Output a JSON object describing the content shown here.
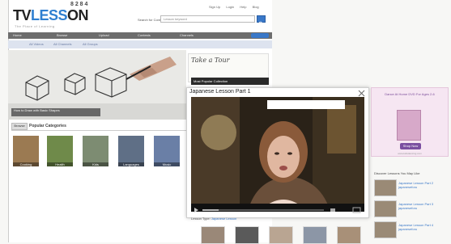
{
  "header": {
    "logo_a": "TV",
    "logo_b": "LESS",
    "logo_c": "ON",
    "logo_extra": "8 2 8 4",
    "tagline": "The Place of Learning",
    "top_links": [
      "Sign Up",
      "Login",
      "Help",
      "Blog"
    ],
    "search_label": "Search for Content",
    "search_placeholder": "Lesson keyword"
  },
  "nav": {
    "items": [
      "Home",
      "Browse",
      "Upload",
      "Contests",
      "Channels"
    ],
    "button": "Upload"
  },
  "subnav": [
    "All Videos",
    "All Channels",
    "All Groups"
  ],
  "hero": {
    "caption": "How to Draw with Basic Shapes"
  },
  "tour": {
    "title": "Take a Tour",
    "tag": "Most Popular Collection"
  },
  "popular": {
    "button": "Browse",
    "label": "Popular Categories",
    "categories": [
      "Cooking",
      "Health",
      "Kids",
      "Languages",
      "Music"
    ]
  },
  "popup": {
    "title": "Japanese Lesson Part 1",
    "meta_prefix": "Lesson Type:",
    "meta_link": "Japanese Lesson"
  },
  "ad": {
    "text": "Dance At Home DVD For Ages 2-6",
    "button": "Shop Now",
    "footer": "www.kidsdancing.com"
  },
  "discover": {
    "heading": "Discover Lessons You May Like",
    "items": [
      "Japanese Lesson Part 2 japaneseforu",
      "Japanese Lesson Part 3 japaneseforu",
      "Japanese Lesson Part 4 japaneseforu"
    ]
  },
  "colors": {
    "accent": "#2f7fd0",
    "nav_bg": "#6d6d6d",
    "ad_purple": "#7a4fa0"
  }
}
